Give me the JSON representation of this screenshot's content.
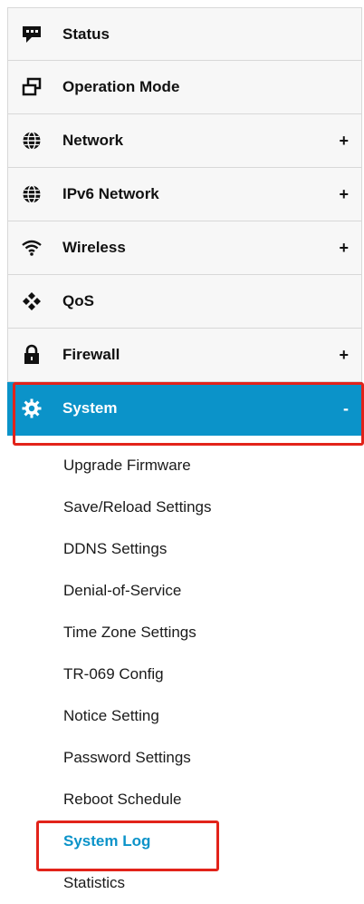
{
  "menu": {
    "items": [
      {
        "label": "Status",
        "icon": "chat-bubble-icon",
        "expander": ""
      },
      {
        "label": "Operation Mode",
        "icon": "windows-icon",
        "expander": ""
      },
      {
        "label": "Network",
        "icon": "globe-icon",
        "expander": "+"
      },
      {
        "label": "IPv6 Network",
        "icon": "globe-icon",
        "expander": "+"
      },
      {
        "label": "Wireless",
        "icon": "wifi-icon",
        "expander": "+"
      },
      {
        "label": "QoS",
        "icon": "qos-icon",
        "expander": ""
      },
      {
        "label": "Firewall",
        "icon": "lock-icon",
        "expander": "+"
      },
      {
        "label": "System",
        "icon": "gear-icon",
        "expander": "-",
        "active": true
      }
    ],
    "system_submenu": [
      "Upgrade Firmware",
      "Save/Reload Settings",
      "DDNS Settings",
      "Denial-of-Service",
      "Time Zone Settings",
      "TR-069 Config",
      "Notice Setting",
      "Password Settings",
      "Reboot Schedule",
      "System Log",
      "Statistics"
    ],
    "selected_submenu": "System Log"
  },
  "colors": {
    "accent": "#0b93c9",
    "highlight": "#e2231a"
  }
}
